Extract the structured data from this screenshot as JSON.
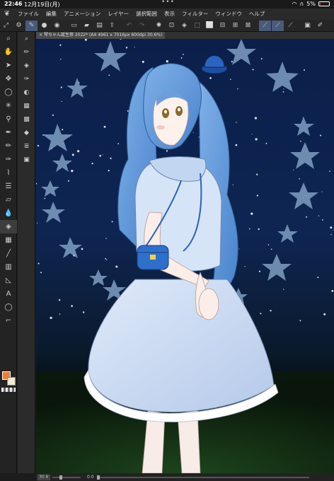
{
  "status": {
    "time": "22:46",
    "date": "12月19日(月)",
    "dots": "•••",
    "battery": "5%"
  },
  "menubar": {
    "items": [
      "ファイル",
      "編集",
      "アニメーション",
      "レイヤー",
      "選択範囲",
      "表示",
      "フィルター",
      "ウィンドウ",
      "ヘルプ"
    ]
  },
  "canvas_tab": {
    "title": "琴ちゃん誕生祭 2022* (A4 4961 x 7016px 600dpi 30.6%)"
  },
  "colors": {
    "main_color": "#f07d2a",
    "sub_color": "#f3ead2"
  },
  "bottom": {
    "zoom": "30.6",
    "rotation": "0.0"
  }
}
